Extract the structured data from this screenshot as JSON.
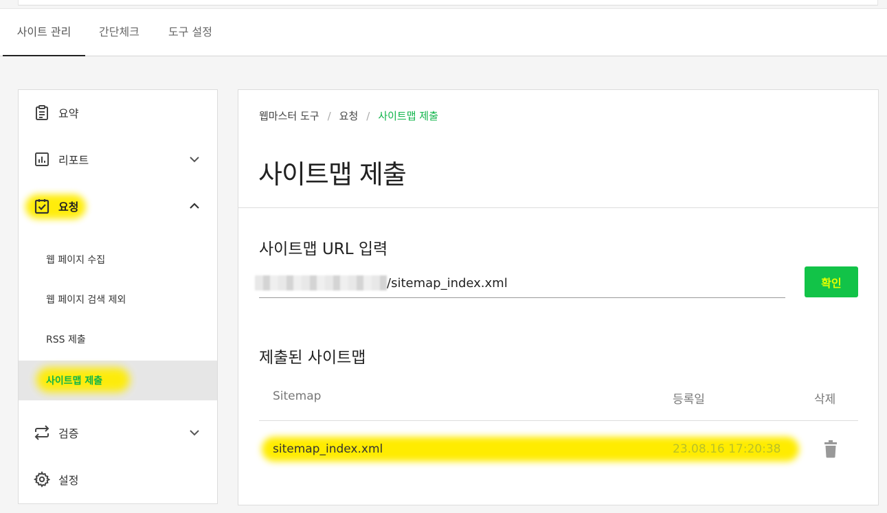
{
  "top_tabs": [
    {
      "label": "사이트 관리",
      "active": true
    },
    {
      "label": "간단체크",
      "active": false
    },
    {
      "label": "도구 설정",
      "active": false
    }
  ],
  "sidebar": {
    "items": [
      {
        "label": "요약",
        "icon": "clipboard-icon"
      },
      {
        "label": "리포트",
        "icon": "bar-chart-icon",
        "expand": "chevron-down-icon"
      },
      {
        "label": "요청",
        "icon": "checkbox-clipboard-icon",
        "expand": "chevron-up-icon",
        "highlighted": true
      },
      {
        "label": "검증",
        "icon": "swap-arrows-icon",
        "expand": "chevron-down-icon"
      },
      {
        "label": "설정",
        "icon": "gear-icon"
      }
    ],
    "sub_items": [
      {
        "label": "웹 페이지 수집"
      },
      {
        "label": "웹 페이지 검색 제외"
      },
      {
        "label": "RSS 제출"
      },
      {
        "label": "사이트맵 제출",
        "active": true
      }
    ]
  },
  "breadcrumb": {
    "items": [
      "웹마스터 도구",
      "요청",
      "사이트맵 제출"
    ],
    "separator": "/"
  },
  "page_title": "사이트맵 제출",
  "url_section": {
    "title": "사이트맵 URL 입력",
    "input_value": "/sitemap_index.xml",
    "confirm_label": "확인"
  },
  "submitted_section": {
    "title": "제출된 사이트맵",
    "columns": [
      "Sitemap",
      "등록일",
      "삭제"
    ],
    "rows": [
      {
        "sitemap": "sitemap_index.xml",
        "date": "23.08.16 17:20:38",
        "delete_icon": "trash-icon"
      }
    ]
  },
  "colors": {
    "accent_green": "#0fb44a",
    "button_green": "#12c348",
    "highlight_yellow": "#ffec00"
  }
}
